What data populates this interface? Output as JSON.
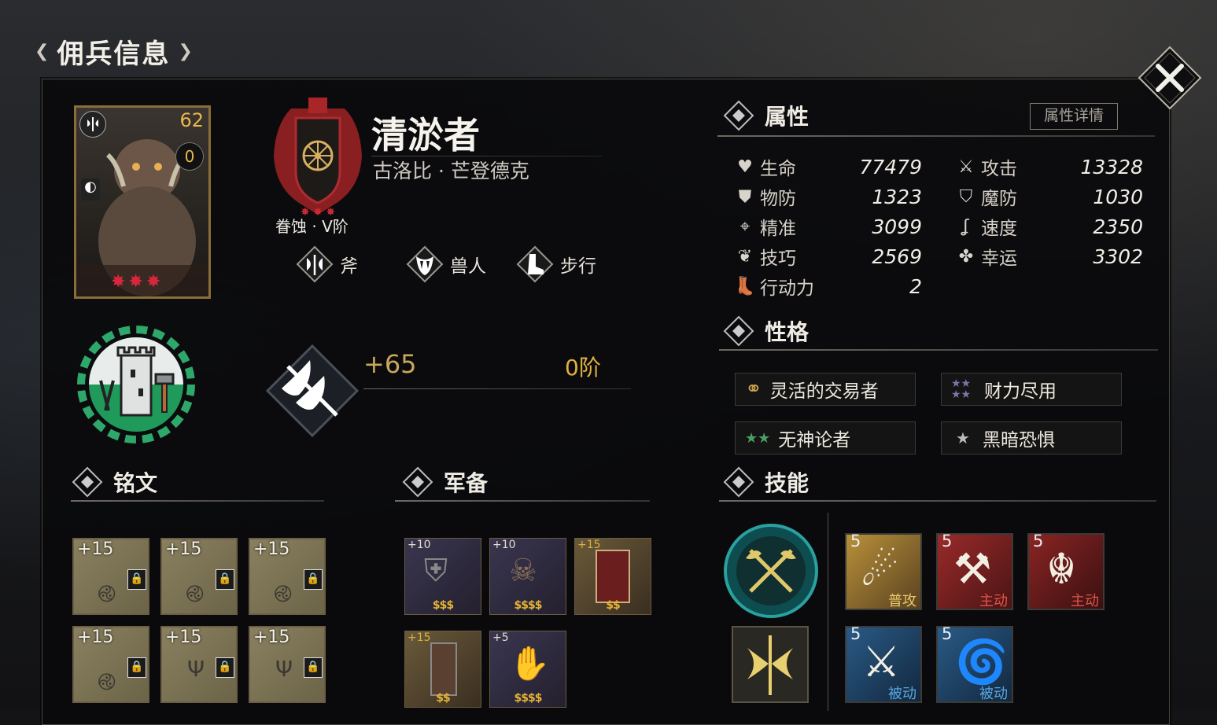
{
  "window": {
    "title": "佣兵信息"
  },
  "hero": {
    "name": "清淤者",
    "origin": "古洛比 · 芒登德克",
    "level": "62",
    "reinforce": "0",
    "rank": "眷蚀 · V阶",
    "tags": [
      {
        "label": "斧",
        "icon": "axe-icon"
      },
      {
        "label": "兽人",
        "icon": "fang-icon"
      },
      {
        "label": "步行",
        "icon": "boot-icon"
      }
    ],
    "weapon_bonus": "+65",
    "weapon_rank": "0阶"
  },
  "attributes": {
    "header": "属性",
    "detail_button": "属性详情",
    "left": [
      {
        "name": "生命",
        "value": "77479",
        "icon": "heart-icon"
      },
      {
        "name": "物防",
        "value": "1323",
        "icon": "shield-icon"
      },
      {
        "name": "精准",
        "value": "3099",
        "icon": "crosshair-icon"
      },
      {
        "name": "技巧",
        "value": "2569",
        "icon": "skill-icon"
      },
      {
        "name": "行动力",
        "value": "2",
        "icon": "boot-icon"
      }
    ],
    "right": [
      {
        "name": "攻击",
        "value": "13328",
        "icon": "crossed-swords-icon"
      },
      {
        "name": "魔防",
        "value": "1030",
        "icon": "magic-shield-icon"
      },
      {
        "name": "速度",
        "value": "2350",
        "icon": "speed-icon"
      },
      {
        "name": "幸运",
        "value": "3302",
        "icon": "clover-icon"
      }
    ]
  },
  "personality": {
    "header": "性格",
    "traits": [
      {
        "label": "灵活的交易者",
        "icon": "rings-icon"
      },
      {
        "label": "财力尽用",
        "icon": "four-stars-icon"
      },
      {
        "label": "无神论者",
        "icon": "two-stars-icon"
      },
      {
        "label": "黑暗恐惧",
        "icon": "one-star-icon"
      }
    ]
  },
  "inscriptions": {
    "header": "铭文",
    "slots": [
      "+15",
      "+15",
      "+15",
      "+15",
      "+15",
      "+15"
    ]
  },
  "equipment": {
    "header": "军备",
    "items": [
      {
        "plus": "+10",
        "coins": "$$$"
      },
      {
        "plus": "+10",
        "coins": "$$$$"
      },
      {
        "plus": "+15",
        "coins": "$$"
      },
      {
        "plus": "+15",
        "coins": "$$"
      },
      {
        "plus": "+5",
        "coins": "$$$$"
      }
    ]
  },
  "skills": {
    "header": "技能",
    "items": [
      {
        "level": "5",
        "tag": "普攻",
        "tag_color": "#e8c86a"
      },
      {
        "level": "5",
        "tag": "主动",
        "tag_color": "#e0544a"
      },
      {
        "level": "5",
        "tag": "主动",
        "tag_color": "#e0544a"
      },
      {
        "level": "5",
        "tag": "被动",
        "tag_color": "#5aa6e0"
      },
      {
        "level": "5",
        "tag": "被动",
        "tag_color": "#5aa6e0"
      }
    ]
  }
}
